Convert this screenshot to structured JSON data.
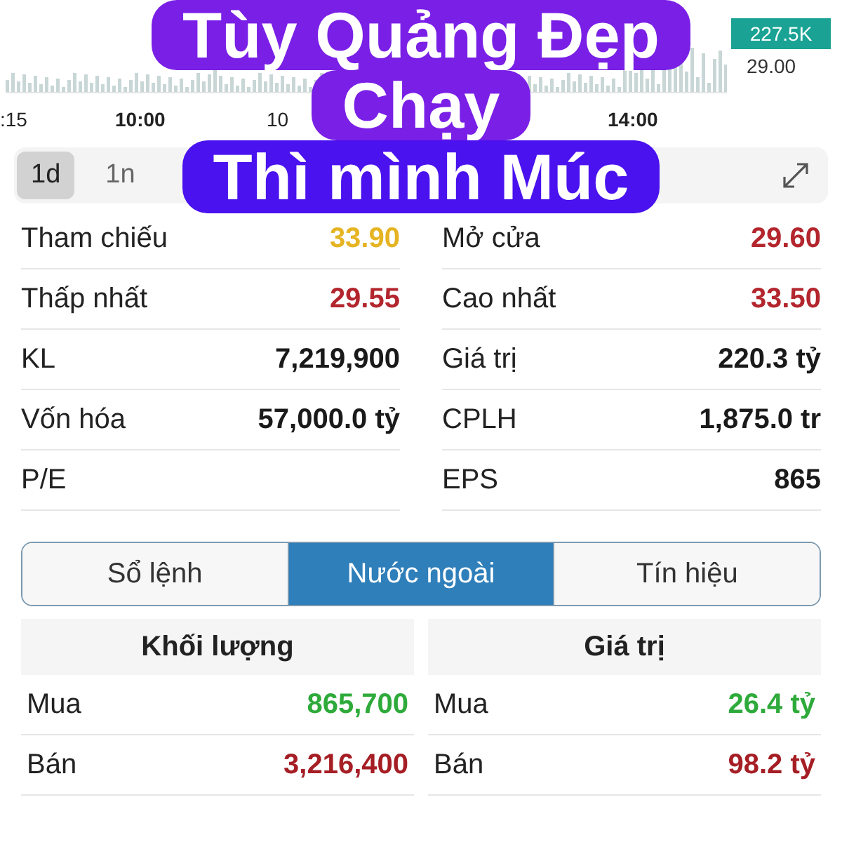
{
  "caption": [
    "Tùy Quảng Đẹp",
    "Chạy",
    "Thì mình Múc"
  ],
  "chart": {
    "badge": "227.5K",
    "price": "29.00",
    "time_labels": [
      ":15",
      "10:00",
      "10",
      "14:00"
    ]
  },
  "timeframes": [
    {
      "label": "1d",
      "selected": true
    },
    {
      "label": "1n",
      "selected": false
    }
  ],
  "stats": [
    {
      "label": "Tham chiếu",
      "value": "33.90",
      "color": "#e6b422"
    },
    {
      "label": "Mở cửa",
      "value": "29.60",
      "color": "#b3262e"
    },
    {
      "label": "Thấp nhất",
      "value": "29.55",
      "color": "#b3262e"
    },
    {
      "label": "Cao nhất",
      "value": "33.50",
      "color": "#b3262e"
    },
    {
      "label": "KL",
      "value": "7,219,900",
      "color": "#1a1a1a"
    },
    {
      "label": "Giá trị",
      "value": "220.3 tỷ",
      "color": "#1a1a1a"
    },
    {
      "label": "Vốn hóa",
      "value": "57,000.0 tỷ",
      "color": "#1a1a1a"
    },
    {
      "label": "CPLH",
      "value": "1,875.0 tr",
      "color": "#1a1a1a"
    },
    {
      "label": "P/E"
    },
    {
      "label": "EPS",
      "value": "865",
      "color": "#1a1a1a"
    }
  ],
  "segments": [
    {
      "label": "Sổ lệnh",
      "selected": false
    },
    {
      "label": "Nước ngoài",
      "selected": true
    },
    {
      "label": "Tín hiệu",
      "selected": false
    }
  ],
  "foreign": {
    "columns": [
      "Khối lượng",
      "Giá trị"
    ],
    "rows": [
      {
        "label": "Mua",
        "volume": "865,700",
        "label_2": "Mua",
        "value": "26.4 tỷ",
        "color": "#2eaa3a"
      },
      {
        "label": "Bán",
        "volume": "3,216,400",
        "label_2": "Bán",
        "value": "98.2 tỷ",
        "color": "#a61e25"
      }
    ]
  }
}
